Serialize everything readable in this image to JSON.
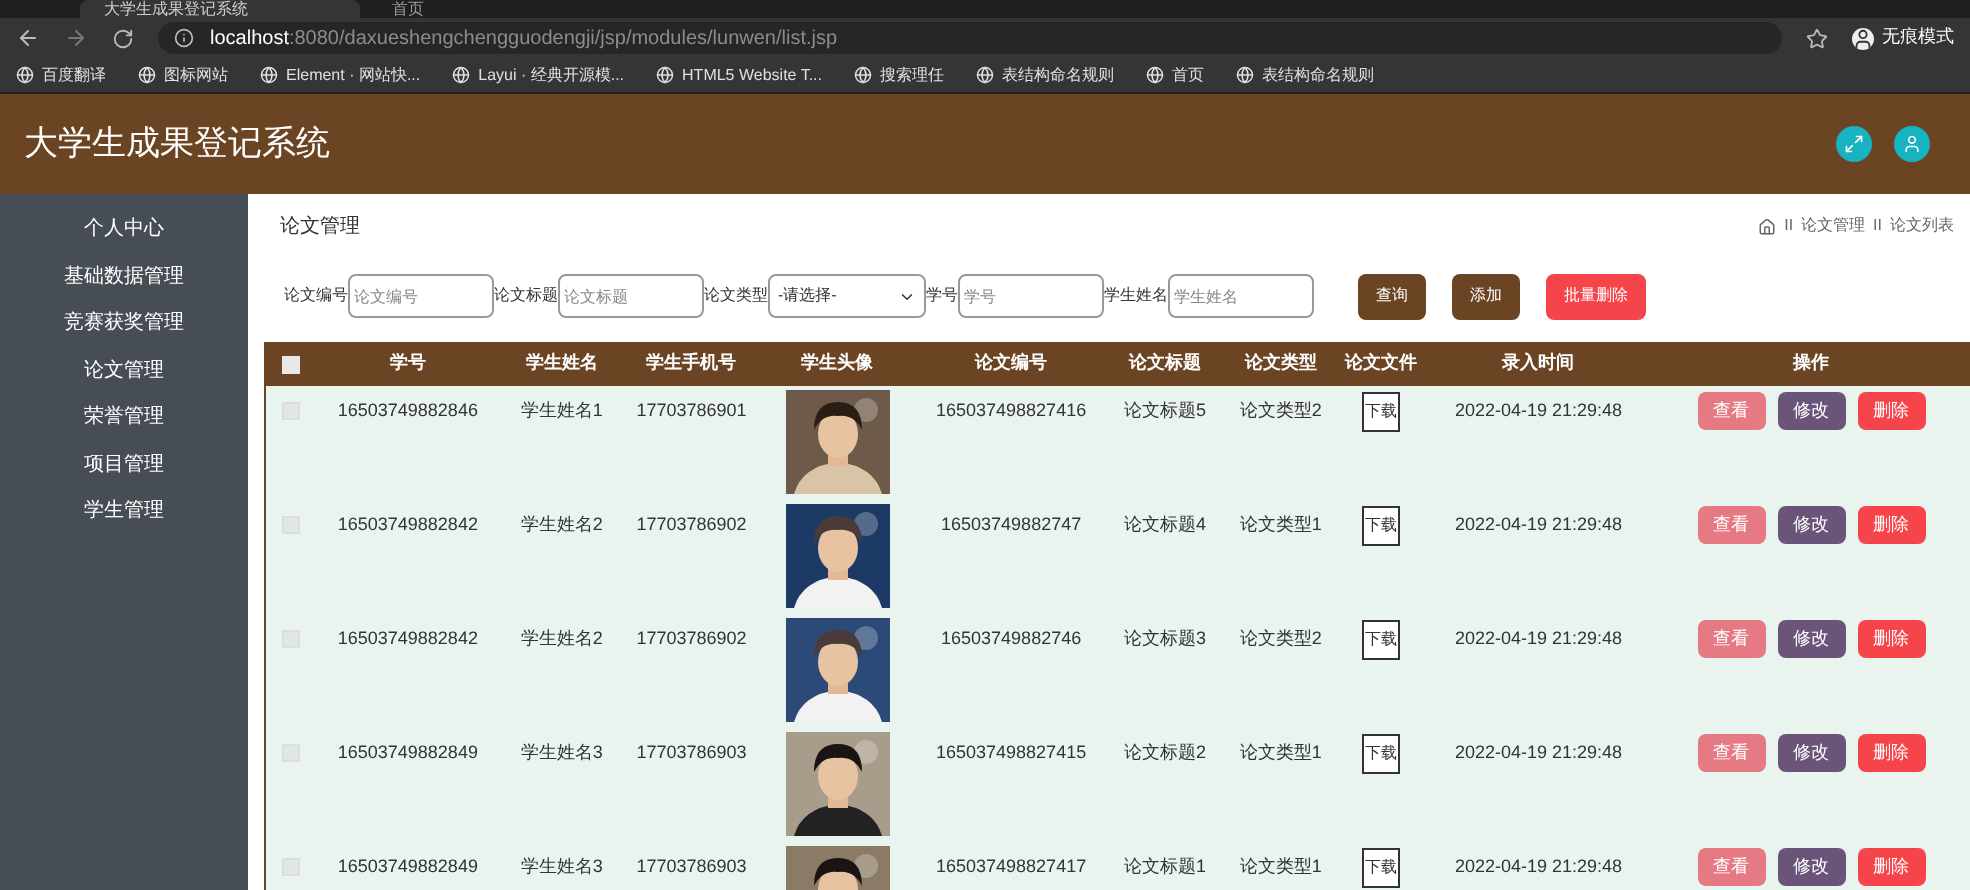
{
  "browser": {
    "tabs": [
      {
        "label": "大学生成果登记系统",
        "selected": true
      },
      {
        "label": "首页",
        "selected": false
      }
    ],
    "url_host": "localhost",
    "url_rest": ":8080/daxueshengchengguodengji/jsp/modules/lunwen/list.jsp",
    "profile": "无痕模式",
    "bookmarks": [
      "百度翻译",
      "图标网站",
      "Element · 网站快...",
      "Layui · 经典开源模...",
      "HTML5 Website T...",
      "搜索理任",
      "表结构命名规则",
      "首页",
      "表结构命名规则"
    ]
  },
  "header": {
    "title": "大学生成果登记系统"
  },
  "sidebar": {
    "items": [
      "个人中心",
      "基础数据管理",
      "竞赛获奖管理",
      "论文管理",
      "荣誉管理",
      "项目管理",
      "学生管理"
    ]
  },
  "page": {
    "title": "论文管理",
    "breadcrumb": [
      {
        "separator": "II",
        "label": "论文管理"
      },
      {
        "separator": "II",
        "label": "论文列表"
      }
    ]
  },
  "filters": [
    {
      "label": "论文编号",
      "placeholder": "论文编号",
      "kind": "input"
    },
    {
      "label": "论文标题",
      "placeholder": "论文标题",
      "kind": "input"
    },
    {
      "label": "论文类型",
      "value": "-请选择-",
      "kind": "select"
    },
    {
      "label": "学号",
      "placeholder": "学号",
      "kind": "input"
    },
    {
      "label": "学生姓名",
      "placeholder": "学生姓名",
      "kind": "input"
    }
  ],
  "actions": [
    {
      "label": "查询",
      "kind": "search"
    },
    {
      "label": "添加",
      "kind": "add"
    },
    {
      "label": "批量删除",
      "kind": "delete"
    }
  ],
  "table": {
    "select_all_checked": false,
    "columns": [
      "学号",
      "学生姓名",
      "学生手机号",
      "学生头像",
      "论文编号",
      "论文标题",
      "论文类型",
      "论文文件",
      "录入时间",
      "操作"
    ],
    "rows": [
      {
        "checked": false,
        "cells": [
          "16503749882846",
          "学生姓名1",
          "17703786901",
          "",
          "165037498827416",
          "论文标题5",
          "论文类型2",
          "下载",
          "2022-04-19 21:29:48"
        ],
        "actions": [
          {
            "label": "查看",
            "kind": "view"
          },
          {
            "label": "修改",
            "kind": "edit"
          },
          {
            "label": "删除",
            "kind": "delete"
          }
        ]
      },
      {
        "checked": false,
        "cells": [
          "16503749882842",
          "学生姓名2",
          "17703786902",
          "",
          "16503749882747",
          "论文标题4",
          "论文类型1",
          "下载",
          "2022-04-19 21:29:48"
        ],
        "actions": [
          {
            "label": "查看",
            "kind": "view"
          },
          {
            "label": "修改",
            "kind": "edit"
          },
          {
            "label": "删除",
            "kind": "delete"
          }
        ]
      },
      {
        "checked": false,
        "cells": [
          "16503749882842",
          "学生姓名2",
          "17703786902",
          "",
          "16503749882746",
          "论文标题3",
          "论文类型2",
          "下载",
          "2022-04-19 21:29:48"
        ],
        "actions": [
          {
            "label": "查看",
            "kind": "view"
          },
          {
            "label": "修改",
            "kind": "edit"
          },
          {
            "label": "删除",
            "kind": "delete"
          }
        ]
      },
      {
        "checked": false,
        "cells": [
          "16503749882849",
          "学生姓名3",
          "17703786903",
          "",
          "165037498827415",
          "论文标题2",
          "论文类型1",
          "下载",
          "2022-04-19 21:29:48"
        ],
        "actions": [
          {
            "label": "查看",
            "kind": "view"
          },
          {
            "label": "修改",
            "kind": "edit"
          },
          {
            "label": "删除",
            "kind": "delete"
          }
        ]
      },
      {
        "checked": false,
        "cells": [
          "16503749882849",
          "学生姓名3",
          "17703786903",
          "",
          "165037498827417",
          "论文标题1",
          "论文类型1",
          "下载",
          "2022-04-19 21:29:48"
        ],
        "actions": [
          {
            "label": "查看",
            "kind": "view"
          },
          {
            "label": "修改",
            "kind": "edit"
          },
          {
            "label": "删除",
            "kind": "delete"
          }
        ]
      }
    ]
  }
}
